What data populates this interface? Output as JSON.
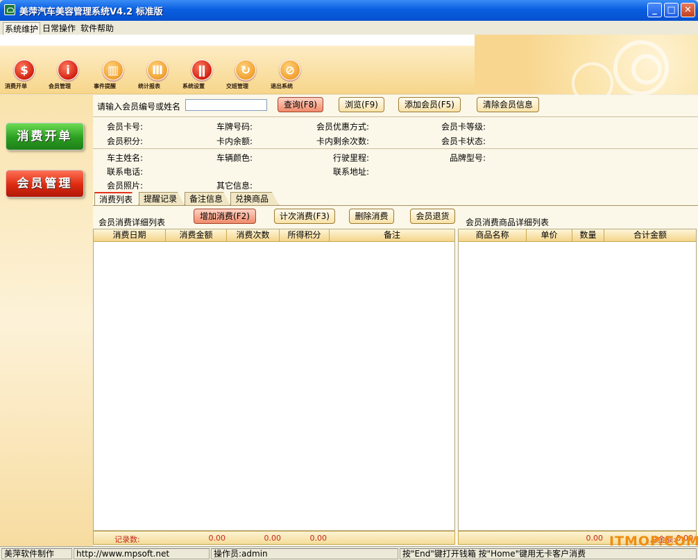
{
  "window": {
    "title": "美萍汽车美容管理系统V4.2 标准版",
    "minimize": "_",
    "maximize": "□",
    "close": "✕"
  },
  "menu": [
    "系统维护",
    "日常操作",
    "软件帮助"
  ],
  "toolbar": [
    {
      "label": "消费开单",
      "icon": "$",
      "icon_name": "dollar-icon"
    },
    {
      "label": "会员管理",
      "icon": "i",
      "icon_name": "member-icon"
    },
    {
      "label": "事件提醒",
      "icon": "▥",
      "icon_name": "calendar-icon"
    },
    {
      "label": "统计报表",
      "icon": "Ⅲ",
      "icon_name": "chart-icon"
    },
    {
      "label": "系统设置",
      "icon": "ǁ",
      "icon_name": "settings-icon"
    },
    {
      "label": "交班管理",
      "icon": "↻",
      "icon_name": "shift-icon"
    },
    {
      "label": "退出系统",
      "icon": "⊘",
      "icon_name": "exit-icon"
    }
  ],
  "sidebar": {
    "consume": "消费开单",
    "member": "会员管理"
  },
  "search": {
    "label": "请输入会员编号或姓名",
    "value": "",
    "query": "查询(F8)",
    "browse": "浏览(F9)",
    "add": "添加会员(F5)",
    "clear": "清除会员信息"
  },
  "info": {
    "card_no": "会员卡号:",
    "plate": "车牌号码:",
    "discount": "会员优惠方式:",
    "card_level": "会员卡等级:",
    "points": "会员积分:",
    "balance": "卡内余额:",
    "remaining": "卡内剩余次数:",
    "card_status": "会员卡状态:",
    "owner": "车主姓名:",
    "color": "车辆颜色:",
    "mileage": "行驶里程:",
    "model": "品牌型号:",
    "phone": "联系电话:",
    "address": "联系地址:",
    "photo": "会员照片:",
    "other": "其它信息:"
  },
  "tabs": [
    "消费列表",
    "提醒记录",
    "备注信息",
    "兑换商品"
  ],
  "left_panel": {
    "title": "会员消费详细列表",
    "actions": {
      "add": "增加消费(F2)",
      "count": "计次消费(F3)",
      "delete": "删除消费",
      "refund": "会员退货"
    },
    "columns": [
      "消费日期",
      "消费金额",
      "消费次数",
      "所得积分",
      "备注"
    ],
    "footer": {
      "records": "记录数:",
      "amount": "0.00",
      "count": "0.00",
      "points": "0.00"
    }
  },
  "right_panel": {
    "title": "会员消费商品详细列表",
    "columns": [
      "商品名称",
      "单价",
      "数量",
      "合计金额"
    ],
    "footer": {
      "amount": "0.00",
      "total_label": "总金额:",
      "total": "0.00"
    }
  },
  "status": {
    "vendor": "美萍软件制作",
    "url": "http://www.mpsoft.net",
    "operator": "操作员:admin",
    "hint": "按\"End\"键打开钱箱  按\"Home\"键用无卡客户消费"
  },
  "watermark": "ITMOP.COM"
}
